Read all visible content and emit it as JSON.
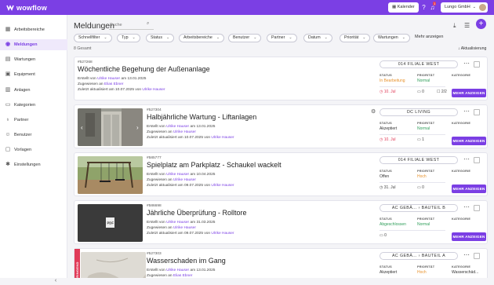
{
  "app": {
    "brand": "wowflow",
    "calendar_label": "Kalender",
    "notification_count": "1",
    "org": "Lungo GmbH"
  },
  "sidebar": {
    "items": [
      {
        "label": "Arbeitsbereiche",
        "icon": "grid-icon"
      },
      {
        "label": "Meldungen",
        "icon": "bell-icon"
      },
      {
        "label": "Wartungen",
        "icon": "calendar-icon"
      },
      {
        "label": "Equipment",
        "icon": "toolbox-icon"
      },
      {
        "label": "Anlagen",
        "icon": "building-icon"
      },
      {
        "label": "Kategorien",
        "icon": "folder-icon"
      },
      {
        "label": "Partner",
        "icon": "users-icon"
      },
      {
        "label": "Benutzer",
        "icon": "user-icon"
      },
      {
        "label": "Vorlagen",
        "icon": "template-icon"
      },
      {
        "label": "Einstellungen",
        "icon": "gear-icon"
      }
    ]
  },
  "page": {
    "title": "Meldungen",
    "search_placeholder": "Suche",
    "total": "8 Gesamt",
    "sort_label": "Aktualisierung",
    "more_filters": "Mehr anzeigen"
  },
  "filters": [
    "Schnellfilter",
    "Typ",
    "Status",
    "Arbeitsbereiche",
    "Benutzer",
    "Partner",
    "Datum",
    "Priorität",
    "Wartungen"
  ],
  "labels": {
    "status": "STATUS",
    "priority": "PRIORITÄT",
    "category": "KATEGORIE",
    "more": "MEHR ANZEIGEN"
  },
  "cards": [
    {
      "id": "#527268",
      "title": "Wöchentliche Begehung der Außenanlage",
      "created_by": "Ulrike Hauser",
      "created_on": "13.01.2025",
      "assigned": "Elias Ebner",
      "updated_by": "Ulrike Hauser",
      "updated_on": "10.07.2025",
      "location": "014 FILIALE WEST",
      "status": "In Bearbeitung",
      "status_color": "#e8922c",
      "priority": "Normal",
      "priority_color": "#2f9e5a",
      "category": "",
      "date": "10. Jul",
      "date_color": "#e03b58",
      "msgs": "0",
      "tasks": "2/2",
      "ribbon": ""
    },
    {
      "id": "#527304",
      "title": "Halbjährliche Wartung - Liftanlagen",
      "created_by": "Ulrike Hauser",
      "created_on": "13.01.2025",
      "assigned": "Ulrike Hauser",
      "updated_by": "Ulrike Hauser",
      "updated_on": "10.07.2025",
      "location": "DC LIVING",
      "status": "Akzeptiert",
      "status_color": "#333333",
      "priority": "Normal",
      "priority_color": "#2f9e5a",
      "category": "",
      "date": "10. Jul",
      "date_color": "#e03b58",
      "msgs": "1",
      "tasks": "",
      "ribbon": ""
    },
    {
      "id": "#585777",
      "title": "Spielplatz am Parkplatz - Schaukel wackelt",
      "created_by": "Ulrike Hauser",
      "created_on": "10.04.2025",
      "assigned": "Ulrike Hauser",
      "updated_by": "Ulrike Hauser",
      "updated_on": "09.07.2025",
      "location": "014 FILIALE WEST",
      "status": "Offen",
      "status_color": "#333333",
      "priority": "Hoch",
      "priority_color": "#e8922c",
      "category": "",
      "date": "31. Jul",
      "date_color": "#444444",
      "msgs": "0",
      "tasks": "",
      "ribbon": ""
    },
    {
      "id": "#586698",
      "title": "Jährliche Überprüfung - Rolltore",
      "created_by": "Ulrike Hauser",
      "created_on": "31.03.2025",
      "assigned": "Ulrike Hauser",
      "updated_by": "Ulrike Hauser",
      "updated_on": "09.07.2025",
      "location": "AC GEBÄ... › BAUTEIL B",
      "status": "Abgeschlossen",
      "status_color": "#2f9e5a",
      "priority": "Normal",
      "priority_color": "#2f9e5a",
      "category": "",
      "date": "",
      "date_color": "#444444",
      "msgs": "0",
      "tasks": "",
      "ribbon": ""
    },
    {
      "id": "#527303",
      "title": "Wasserschaden im Gang",
      "created_by": "Ulrike Hauser",
      "created_on": "13.01.2025",
      "assigned": "Elias Ebner",
      "updated_by": "",
      "updated_on": "",
      "location": "AC GEBÄ... › BAUTEIL A",
      "status": "Akzeptiert",
      "status_color": "#333333",
      "priority": "Hoch",
      "priority_color": "#e8922c",
      "category": "Wasserschäd...",
      "date": "",
      "date_color": "#444444",
      "msgs": "",
      "tasks": "",
      "ribbon": "DRINGEND"
    }
  ],
  "pdf_label": "PDF"
}
